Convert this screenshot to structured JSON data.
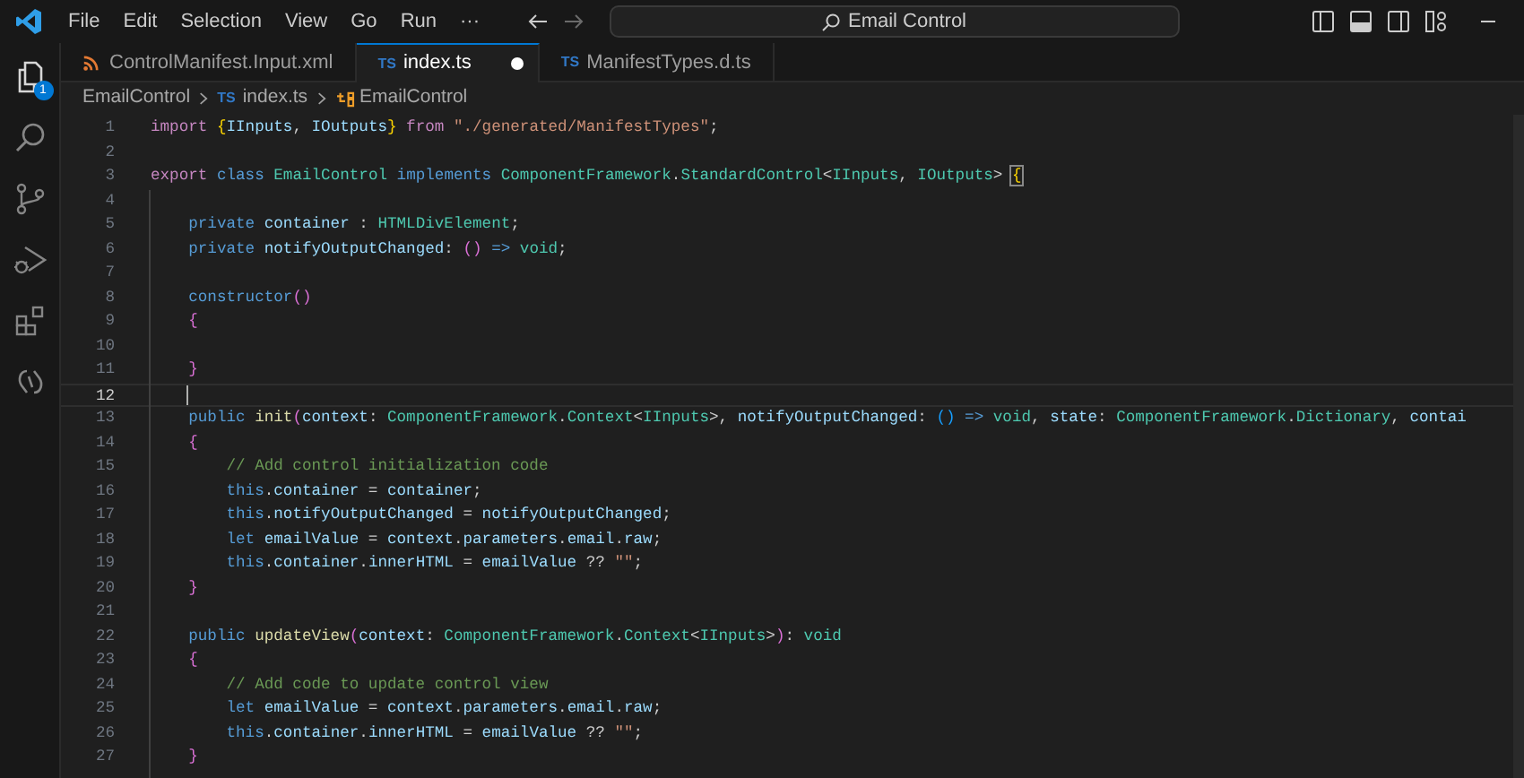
{
  "menu": [
    "File",
    "Edit",
    "Selection",
    "View",
    "Go",
    "Run",
    "···"
  ],
  "search": {
    "value": "Email Control"
  },
  "activity_bar": {
    "explorer_badge": "1"
  },
  "tabs": [
    {
      "label": "ControlManifest.Input.xml",
      "kind": "xml",
      "selected": false,
      "modified": false
    },
    {
      "label": "index.ts",
      "kind": "ts",
      "icon_text": "TS",
      "selected": true,
      "modified": true
    },
    {
      "label": "ManifestTypes.d.ts",
      "kind": "ts",
      "icon_text": "TS",
      "selected": false,
      "modified": false
    }
  ],
  "breadcrumbs": [
    {
      "label": "EmailControl",
      "kind": "folder"
    },
    {
      "label": "index.ts",
      "kind": "ts",
      "icon_text": "TS"
    },
    {
      "label": "EmailControl",
      "kind": "class"
    }
  ],
  "code_lines": [
    {
      "number": "1",
      "current": false,
      "tokens": [
        {
          "kind": "kw",
          "text": "import"
        },
        {
          "kind": "b1",
          "text": " {"
        },
        {
          "kind": "var",
          "text": "IInputs"
        },
        {
          "kind": "pun",
          "text": ", "
        },
        {
          "kind": "var",
          "text": "IOutputs"
        },
        {
          "kind": "b1",
          "text": "}"
        },
        {
          "kind": "kw",
          "text": " from"
        },
        {
          "kind": "str",
          "text": " \"./generated/ManifestTypes\""
        },
        {
          "kind": "pun",
          "text": ";"
        }
      ]
    },
    {
      "number": "2",
      "current": false
    },
    {
      "number": "3",
      "current": false,
      "tokens": [
        {
          "kind": "kw",
          "text": "export"
        },
        {
          "kind": "st",
          "text": " class"
        },
        {
          "kind": "type",
          "text": " EmailControl"
        },
        {
          "kind": "st",
          "text": " implements"
        },
        {
          "kind": "type",
          "text": " ComponentFramework"
        },
        {
          "kind": "pun",
          "text": "."
        },
        {
          "kind": "type",
          "text": "StandardControl"
        },
        {
          "kind": "pun",
          "text": "<"
        },
        {
          "kind": "type",
          "text": "IInputs"
        },
        {
          "kind": "pun",
          "text": ", "
        },
        {
          "kind": "type",
          "text": "IOutputs"
        },
        {
          "kind": "pun",
          "text": "> "
        },
        {
          "kind": "b1m",
          "text": "{"
        }
      ]
    },
    {
      "number": "4",
      "current": false
    },
    {
      "number": "5",
      "current": false,
      "tokens": [
        {
          "kind": "st",
          "text": "    private"
        },
        {
          "kind": "var",
          "text": " container"
        },
        {
          "kind": "pun",
          "text": " : "
        },
        {
          "kind": "type",
          "text": "HTMLDivElement"
        },
        {
          "kind": "pun",
          "text": ";"
        }
      ]
    },
    {
      "number": "6",
      "current": false,
      "tokens": [
        {
          "kind": "st",
          "text": "    private"
        },
        {
          "kind": "var",
          "text": " notifyOutputChanged"
        },
        {
          "kind": "pun",
          "text": ": "
        },
        {
          "kind": "b2",
          "text": "()"
        },
        {
          "kind": "st",
          "text": " =>"
        },
        {
          "kind": "type",
          "text": " void"
        },
        {
          "kind": "pun",
          "text": ";"
        }
      ]
    },
    {
      "number": "7",
      "current": false
    },
    {
      "number": "8",
      "current": false,
      "tokens": [
        {
          "kind": "st",
          "text": "    constructor"
        },
        {
          "kind": "b2",
          "text": "()"
        }
      ]
    },
    {
      "number": "9",
      "current": false,
      "tokens": [
        {
          "kind": "b2",
          "text": "    {"
        }
      ]
    },
    {
      "number": "10",
      "current": false
    },
    {
      "number": "11",
      "current": false,
      "tokens": [
        {
          "kind": "b2",
          "text": "    }"
        }
      ]
    },
    {
      "number": "12",
      "current": true
    },
    {
      "number": "13",
      "current": false,
      "tokens": [
        {
          "kind": "st",
          "text": "    public"
        },
        {
          "kind": "fn",
          "text": " init"
        },
        {
          "kind": "b2",
          "text": "("
        },
        {
          "kind": "var",
          "text": "context"
        },
        {
          "kind": "pun",
          "text": ": "
        },
        {
          "kind": "type",
          "text": "ComponentFramework"
        },
        {
          "kind": "pun",
          "text": "."
        },
        {
          "kind": "type",
          "text": "Context"
        },
        {
          "kind": "pun",
          "text": "<"
        },
        {
          "kind": "type",
          "text": "IInputs"
        },
        {
          "kind": "pun",
          "text": ">, "
        },
        {
          "kind": "var",
          "text": "notifyOutputChanged"
        },
        {
          "kind": "pun",
          "text": ": "
        },
        {
          "kind": "b3",
          "text": "()"
        },
        {
          "kind": "st",
          "text": " =>"
        },
        {
          "kind": "type",
          "text": " void"
        },
        {
          "kind": "pun",
          "text": ", "
        },
        {
          "kind": "var",
          "text": "state"
        },
        {
          "kind": "pun",
          "text": ": "
        },
        {
          "kind": "type",
          "text": "ComponentFramework"
        },
        {
          "kind": "pun",
          "text": "."
        },
        {
          "kind": "type",
          "text": "Dictionary"
        },
        {
          "kind": "pun",
          "text": ", "
        },
        {
          "kind": "var",
          "text": "contai"
        }
      ]
    },
    {
      "number": "14",
      "current": false,
      "tokens": [
        {
          "kind": "b2",
          "text": "    {"
        }
      ]
    },
    {
      "number": "15",
      "current": false,
      "tokens": [
        {
          "kind": "cmt",
          "text": "        // Add control initialization code"
        }
      ]
    },
    {
      "number": "16",
      "current": false,
      "tokens": [
        {
          "kind": "st",
          "text": "        this"
        },
        {
          "kind": "pun",
          "text": "."
        },
        {
          "kind": "var",
          "text": "container"
        },
        {
          "kind": "pun",
          "text": " = "
        },
        {
          "kind": "var",
          "text": "container"
        },
        {
          "kind": "pun",
          "text": ";"
        }
      ]
    },
    {
      "number": "17",
      "current": false,
      "tokens": [
        {
          "kind": "st",
          "text": "        this"
        },
        {
          "kind": "pun",
          "text": "."
        },
        {
          "kind": "var",
          "text": "notifyOutputChanged"
        },
        {
          "kind": "pun",
          "text": " = "
        },
        {
          "kind": "var",
          "text": "notifyOutputChanged"
        },
        {
          "kind": "pun",
          "text": ";"
        }
      ]
    },
    {
      "number": "18",
      "current": false,
      "tokens": [
        {
          "kind": "st",
          "text": "        let"
        },
        {
          "kind": "var",
          "text": " emailValue"
        },
        {
          "kind": "pun",
          "text": " = "
        },
        {
          "kind": "var",
          "text": "context"
        },
        {
          "kind": "pun",
          "text": "."
        },
        {
          "kind": "var",
          "text": "parameters"
        },
        {
          "kind": "pun",
          "text": "."
        },
        {
          "kind": "var",
          "text": "email"
        },
        {
          "kind": "pun",
          "text": "."
        },
        {
          "kind": "var",
          "text": "raw"
        },
        {
          "kind": "pun",
          "text": ";"
        }
      ]
    },
    {
      "number": "19",
      "current": false,
      "tokens": [
        {
          "kind": "st",
          "text": "        this"
        },
        {
          "kind": "pun",
          "text": "."
        },
        {
          "kind": "var",
          "text": "container"
        },
        {
          "kind": "pun",
          "text": "."
        },
        {
          "kind": "var",
          "text": "innerHTML"
        },
        {
          "kind": "pun",
          "text": " = "
        },
        {
          "kind": "var",
          "text": "emailValue"
        },
        {
          "kind": "pun",
          "text": " ?? "
        },
        {
          "kind": "str",
          "text": "\"\""
        },
        {
          "kind": "pun",
          "text": ";"
        }
      ]
    },
    {
      "number": "20",
      "current": false,
      "tokens": [
        {
          "kind": "b2",
          "text": "    }"
        }
      ]
    },
    {
      "number": "21",
      "current": false
    },
    {
      "number": "22",
      "current": false,
      "tokens": [
        {
          "kind": "st",
          "text": "    public"
        },
        {
          "kind": "fn",
          "text": " updateView"
        },
        {
          "kind": "b2",
          "text": "("
        },
        {
          "kind": "var",
          "text": "context"
        },
        {
          "kind": "pun",
          "text": ": "
        },
        {
          "kind": "type",
          "text": "ComponentFramework"
        },
        {
          "kind": "pun",
          "text": "."
        },
        {
          "kind": "type",
          "text": "Context"
        },
        {
          "kind": "pun",
          "text": "<"
        },
        {
          "kind": "type",
          "text": "IInputs"
        },
        {
          "kind": "pun",
          "text": ">"
        },
        {
          "kind": "b2",
          "text": ")"
        },
        {
          "kind": "pun",
          "text": ": "
        },
        {
          "kind": "type",
          "text": "void"
        }
      ]
    },
    {
      "number": "23",
      "current": false,
      "tokens": [
        {
          "kind": "b2",
          "text": "    {"
        }
      ]
    },
    {
      "number": "24",
      "current": false,
      "tokens": [
        {
          "kind": "cmt",
          "text": "        // Add code to update control view"
        }
      ]
    },
    {
      "number": "25",
      "current": false,
      "tokens": [
        {
          "kind": "st",
          "text": "        let"
        },
        {
          "kind": "var",
          "text": " emailValue"
        },
        {
          "kind": "pun",
          "text": " = "
        },
        {
          "kind": "var",
          "text": "context"
        },
        {
          "kind": "pun",
          "text": "."
        },
        {
          "kind": "var",
          "text": "parameters"
        },
        {
          "kind": "pun",
          "text": "."
        },
        {
          "kind": "var",
          "text": "email"
        },
        {
          "kind": "pun",
          "text": "."
        },
        {
          "kind": "var",
          "text": "raw"
        },
        {
          "kind": "pun",
          "text": ";"
        }
      ]
    },
    {
      "number": "26",
      "current": false,
      "tokens": [
        {
          "kind": "st",
          "text": "        this"
        },
        {
          "kind": "pun",
          "text": "."
        },
        {
          "kind": "var",
          "text": "container"
        },
        {
          "kind": "pun",
          "text": "."
        },
        {
          "kind": "var",
          "text": "innerHTML"
        },
        {
          "kind": "pun",
          "text": " = "
        },
        {
          "kind": "var",
          "text": "emailValue"
        },
        {
          "kind": "pun",
          "text": " ?? "
        },
        {
          "kind": "str",
          "text": "\"\""
        },
        {
          "kind": "pun",
          "text": ";"
        }
      ]
    },
    {
      "number": "27",
      "current": false,
      "tokens": [
        {
          "kind": "b2",
          "text": "    }"
        }
      ]
    }
  ]
}
